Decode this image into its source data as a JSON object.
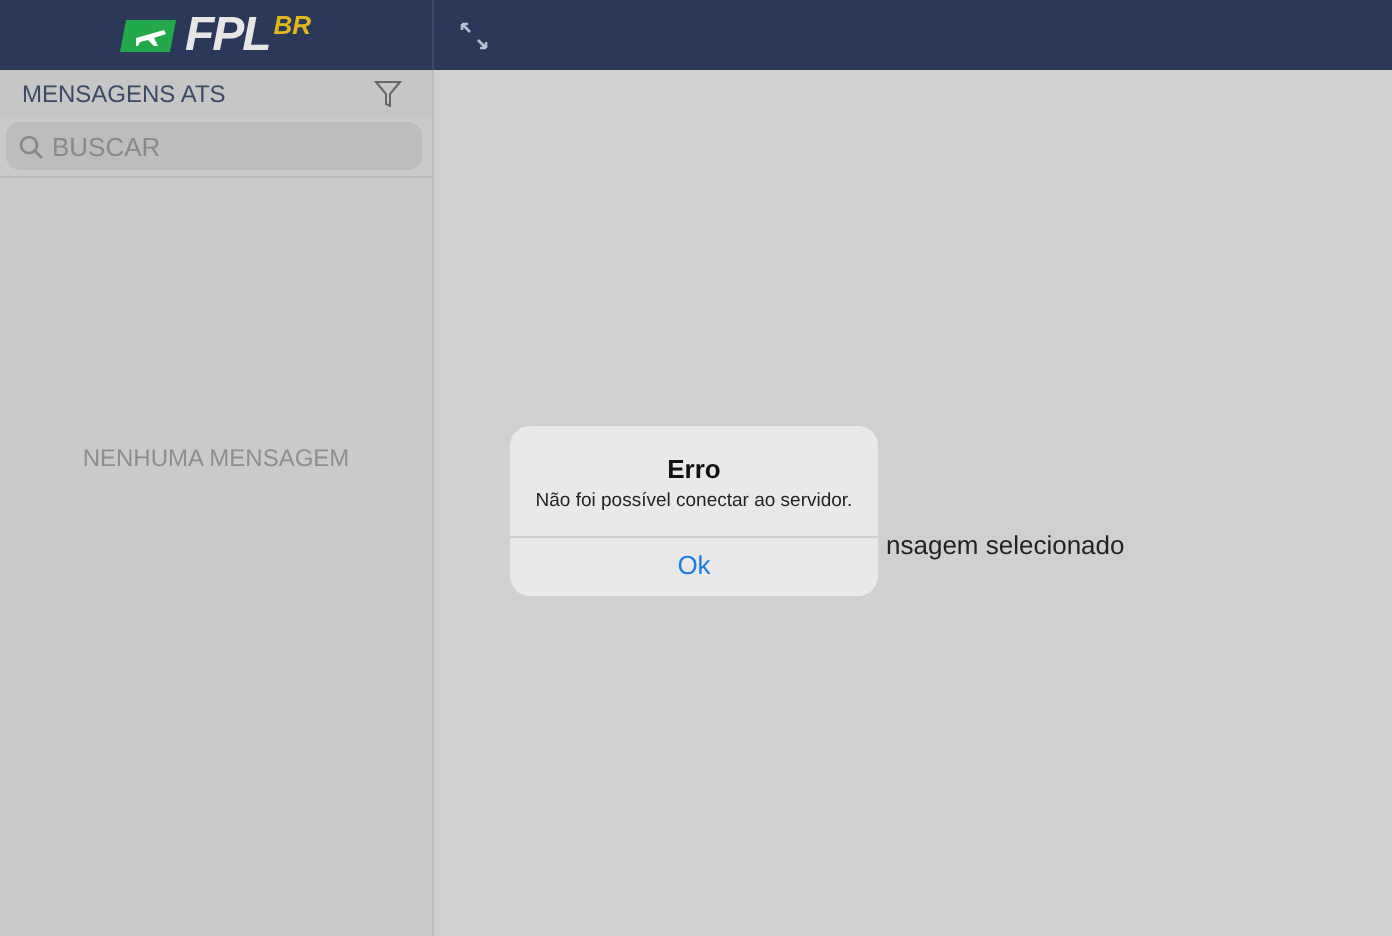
{
  "logo": {
    "text": "FPL",
    "suffix": "BR"
  },
  "sidebar": {
    "title": "MENSAGENS ATS",
    "search": {
      "placeholder": "BUSCAR"
    },
    "empty_text": "NENHUMA MENSAGEM"
  },
  "main": {
    "text": "nsagem selecionado"
  },
  "dialog": {
    "title": "Erro",
    "message": "Não foi possível conectar ao servidor.",
    "buttons": [
      "Ok"
    ]
  }
}
